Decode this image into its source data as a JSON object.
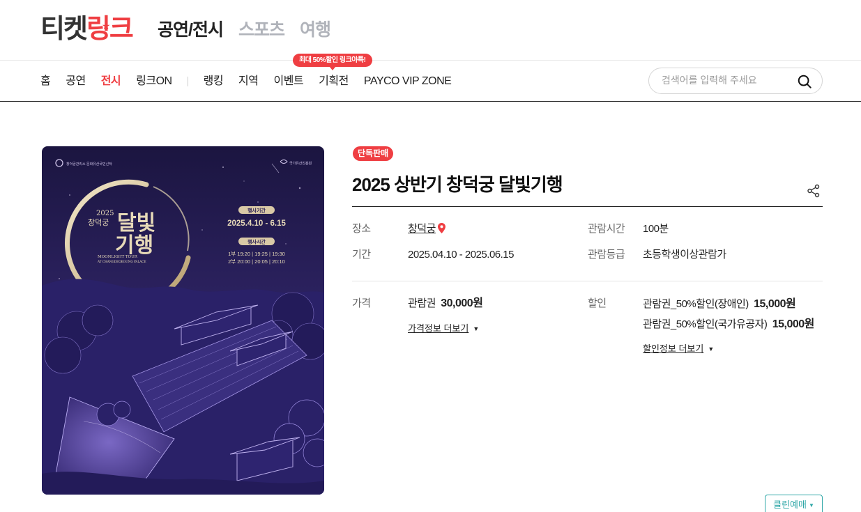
{
  "header": {
    "logo_part1": "티켓",
    "logo_part2": "링크",
    "categories": [
      {
        "label": "공연/전시",
        "active": true
      },
      {
        "label": "스포츠",
        "active": false
      },
      {
        "label": "여행",
        "active": false
      }
    ]
  },
  "nav": {
    "items_main": [
      "홈",
      "공연",
      "전시",
      "링크ON"
    ],
    "items_sub": [
      "랭킹",
      "지역",
      "이벤트",
      "기획전",
      "PAYCO VIP ZONE"
    ],
    "active_item": "전시",
    "promo_bubble": "최대 50%할인 링크야특!",
    "search_placeholder": "검색어를 입력해 주세요"
  },
  "poster": {
    "org_left": "창덕궁관리소 문화유산국민신탁",
    "org_right": "국가유산진흥원",
    "year": "2025",
    "subtitle": "창덕궁",
    "title_line1": "달빛",
    "title_line2": "기행",
    "english_line1": "MOONLIGHT TOUR",
    "english_line2": "AT CHANGDEOKGUNG PALACE",
    "period_label": "행사기간",
    "period_value": "2025.4.10 - 6.15",
    "time_label": "행사시간",
    "time_row1": "1부 19:20 | 19:25 | 19:30",
    "time_row2": "2부 20:00 | 20:05 | 20:10"
  },
  "product": {
    "badge": "단독판매",
    "title": "2025 상반기 창덕궁 달빛기행",
    "info": {
      "venue_label": "장소",
      "venue_value": "창덕궁",
      "period_label": "기간",
      "period_value": "2025.04.10 - 2025.06.15",
      "runtime_label": "관람시간",
      "runtime_value": "100분",
      "rating_label": "관람등급",
      "rating_value": "초등학생이상관람가"
    },
    "price": {
      "label": "가격",
      "item_name": "관람권",
      "item_price": "30,000원",
      "more_label": "가격정보 더보기"
    },
    "discount": {
      "label": "할인",
      "items": [
        {
          "name": "관람권_50%할인(장애인)",
          "price": "15,000원"
        },
        {
          "name": "관람권_50%할인(국가유공자)",
          "price": "15,000원"
        }
      ],
      "more_label": "할인정보 더보기"
    },
    "clean_button": "클린예매"
  },
  "colors": {
    "brand_red": "#ef3e42",
    "poster_bg": "#2a1f55",
    "poster_gold": "#d9c9a6",
    "clean_teal": "#2fa7a7"
  }
}
